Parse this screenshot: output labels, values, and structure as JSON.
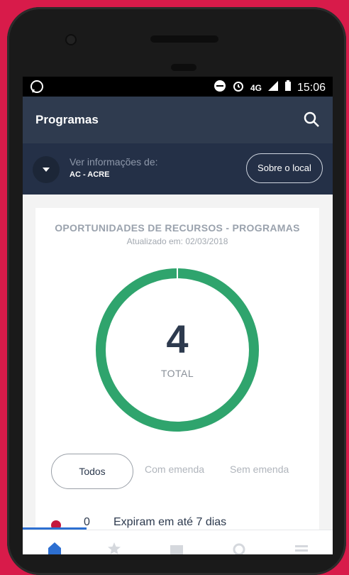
{
  "statusbar": {
    "left_icon": "whatsapp-icon",
    "network": "4G",
    "time": "15:06",
    "icons": [
      "do-not-disturb-icon",
      "alarm-icon",
      "signal-icon",
      "battery-icon"
    ]
  },
  "appbar": {
    "title": "Programas",
    "search_icon": "search-icon"
  },
  "location": {
    "caption": "Ver informações de:",
    "value": "AC - ACRE",
    "about_button": "Sobre o local"
  },
  "card": {
    "title": "OPORTUNIDADES DE RECURSOS - PROGRAMAS",
    "updated": "Atualizado em: 02/03/2018",
    "total_value": "4",
    "total_label": "TOTAL",
    "donut_fill_fraction": 1.0,
    "donut_color": "#2fa46d"
  },
  "filters": {
    "active": "Todos",
    "options": [
      "Com emenda",
      "Sem emenda"
    ]
  },
  "list": {
    "rows": [
      {
        "count": "0",
        "text": "Expiram em até 7 dias",
        "dot_color": "#c4163d"
      }
    ]
  },
  "bottom_nav": [
    "home-icon",
    "star-icon",
    "mail-icon",
    "settings-icon",
    "menu-icon"
  ]
}
